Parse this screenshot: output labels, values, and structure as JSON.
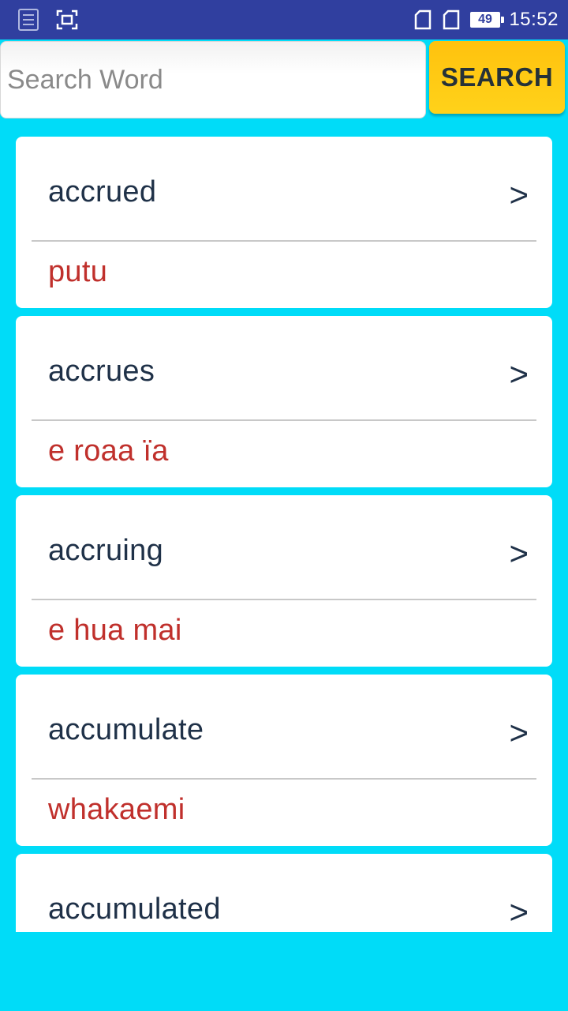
{
  "status_bar": {
    "time": "15:52",
    "battery": "49",
    "icons": [
      "app-notification-icon",
      "screenshot-icon",
      "sim-card-1-icon",
      "sim-card-2-icon",
      "battery-icon"
    ]
  },
  "search": {
    "placeholder": "Search Word",
    "value": "",
    "button_label": "SEARCH"
  },
  "colors": {
    "background": "#00dcf8",
    "status_bar": "#303f9f",
    "button": "#ffc20e",
    "word_text": "#1f3148",
    "translation_text": "#c0302c"
  },
  "results": [
    {
      "word": "accrued",
      "translation": "putu",
      "chevron": ">"
    },
    {
      "word": "accrues",
      "translation": "e roaa ïa",
      "chevron": ">"
    },
    {
      "word": "accruing",
      "translation": "e hua mai",
      "chevron": ">"
    },
    {
      "word": "accumulate",
      "translation": "whakaemi",
      "chevron": ">"
    },
    {
      "word": "accumulated",
      "translation": "",
      "chevron": ">"
    }
  ]
}
